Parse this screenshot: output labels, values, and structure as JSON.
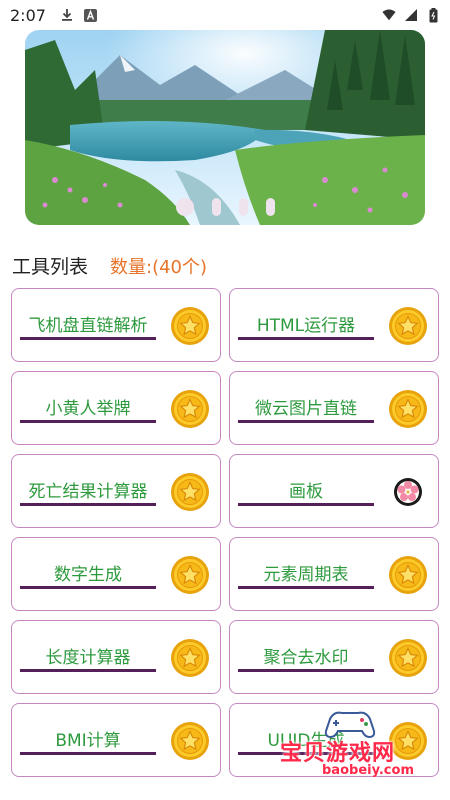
{
  "status_bar": {
    "time": "2:07",
    "left_icons": [
      "download-icon",
      "font-a-icon"
    ],
    "right_icons": [
      "wifi-icon",
      "signal-icon",
      "battery-icon"
    ]
  },
  "banner": {
    "slide_count": 4,
    "active_slide": 0
  },
  "section": {
    "title": "工具列表",
    "count_text": "数量:(40个)"
  },
  "tools": [
    {
      "label": "飞机盘直链解析",
      "icon": "star-coin-icon"
    },
    {
      "label": "HTML运行器",
      "icon": "star-coin-icon"
    },
    {
      "label": "小黄人举牌",
      "icon": "star-coin-icon"
    },
    {
      "label": "微云图片直链",
      "icon": "star-coin-icon"
    },
    {
      "label": "死亡结果计算器",
      "icon": "star-coin-icon"
    },
    {
      "label": "画板",
      "icon": "flower-icon"
    },
    {
      "label": "数字生成",
      "icon": "star-coin-icon"
    },
    {
      "label": "元素周期表",
      "icon": "star-coin-icon"
    },
    {
      "label": "长度计算器",
      "icon": "star-coin-icon"
    },
    {
      "label": "聚合去水印",
      "icon": "star-coin-icon"
    },
    {
      "label": "BMI计算",
      "icon": "star-coin-icon"
    },
    {
      "label": "UUID生成",
      "icon": "star-coin-icon"
    }
  ],
  "colors": {
    "label_green": "#2e9a3e",
    "underline_purple": "#55205a",
    "card_border": "#c489c2",
    "count_orange": "#e6742b",
    "dot": "#efe3ee"
  },
  "watermark": {
    "title": "宝贝游戏网",
    "url": "baobeiy.com"
  }
}
